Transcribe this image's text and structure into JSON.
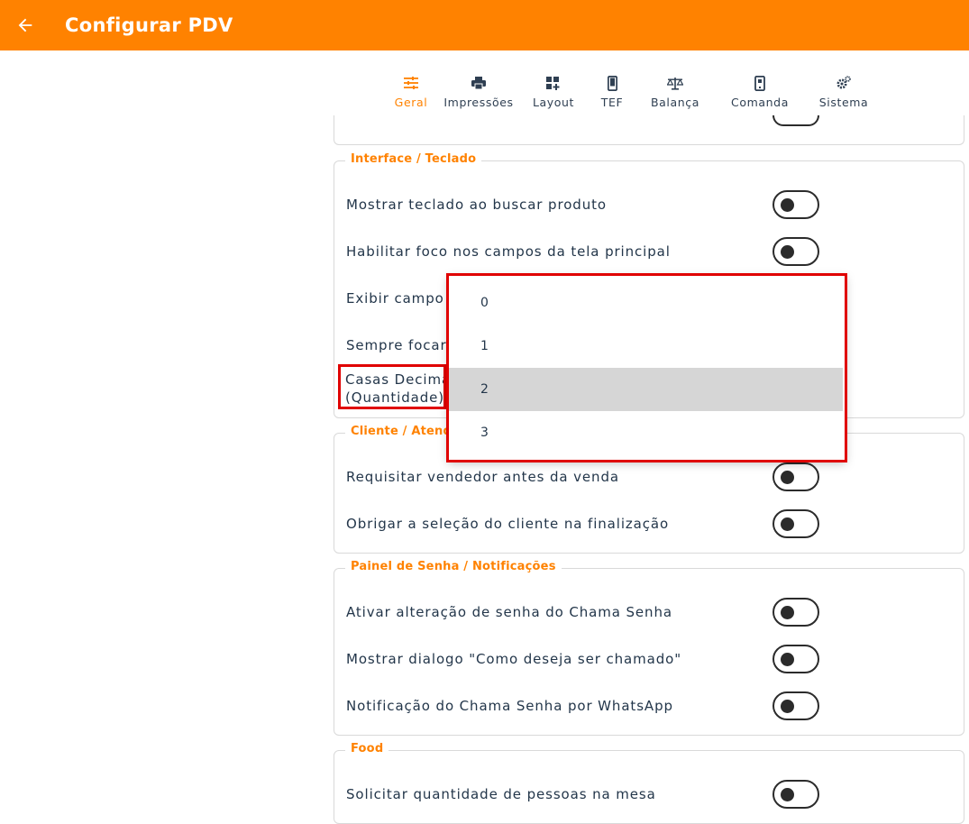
{
  "header": {
    "title": "Configurar PDV",
    "back_icon": "arrow-left-icon"
  },
  "colors": {
    "accent": "#ff8200",
    "highlight": "#e00000"
  },
  "tabs": [
    {
      "label": "Geral",
      "icon": "sliders-icon",
      "active": true
    },
    {
      "label": "Impressões",
      "icon": "printer-icon",
      "active": false
    },
    {
      "label": "Layout",
      "icon": "dashboard-add-icon",
      "active": false
    },
    {
      "label": "TEF",
      "icon": "phone-icon",
      "active": false
    },
    {
      "label": "Balança",
      "icon": "scale-icon",
      "active": false
    },
    {
      "label": "Comanda",
      "icon": "phone-lock-icon",
      "active": false
    },
    {
      "label": "Sistema",
      "icon": "gears-icon",
      "active": false
    }
  ],
  "sections": {
    "interface": {
      "legend": "Interface / Teclado",
      "rows": [
        {
          "label": "Mostrar teclado ao buscar produto",
          "enabled": false
        },
        {
          "label": "Habilitar foco nos campos da tela principal",
          "enabled": false
        },
        {
          "label": "Exibir campo d",
          "enabled": false
        },
        {
          "label": "Sempre focar",
          "enabled": false
        }
      ],
      "casas_line1": "Casas Decima",
      "casas_line2": "(Quantidade)"
    },
    "cliente": {
      "legend": "Cliente / Atendim",
      "rows": [
        {
          "label": "Requisitar vendedor antes da venda",
          "enabled": false
        },
        {
          "label": "Obrigar a seleção do cliente na finalização",
          "enabled": false
        }
      ]
    },
    "painel": {
      "legend": "Painel de Senha / Notificações",
      "rows": [
        {
          "label": "Ativar alteração de senha do Chama Senha",
          "enabled": false
        },
        {
          "label": "Mostrar dialogo \"Como deseja ser chamado\"",
          "enabled": false
        },
        {
          "label": "Notificação do Chama Senha por WhatsApp",
          "enabled": false
        }
      ]
    },
    "food": {
      "legend": "Food",
      "rows": [
        {
          "label": "Solicitar quantidade de pessoas na mesa",
          "enabled": false
        }
      ]
    }
  },
  "dropdown": {
    "options": [
      "0",
      "1",
      "2",
      "3"
    ],
    "selected": "2"
  }
}
